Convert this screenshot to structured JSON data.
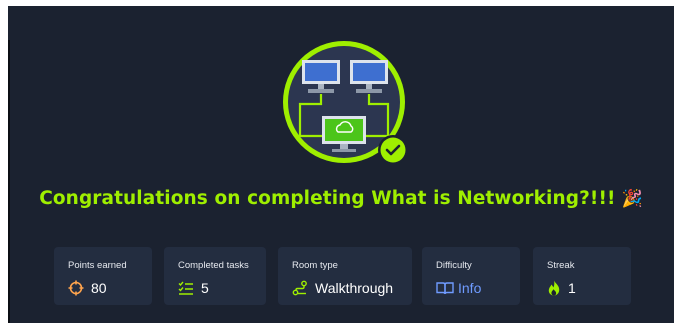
{
  "title": "Congratulations on completing What is Networking?!!!",
  "title_emoji": "🎉",
  "colors": {
    "background": "#1b2230",
    "card": "#232d40",
    "accent": "#9fef00",
    "info": "#6f9bff",
    "points_icon": "#ffa44d",
    "streak_icon": "#9fef00"
  },
  "badge": {
    "icon": "networking-badge-icon",
    "check_icon": "check-icon"
  },
  "stats": [
    {
      "label": "Points earned",
      "value": "80",
      "icon": "crosshair-icon"
    },
    {
      "label": "Completed tasks",
      "value": "5",
      "icon": "task-list-icon"
    },
    {
      "label": "Room type",
      "value": "Walkthrough",
      "icon": "route-icon"
    },
    {
      "label": "Difficulty",
      "value": "Info",
      "icon": "book-icon"
    },
    {
      "label": "Streak",
      "value": "1",
      "icon": "flame-icon"
    }
  ]
}
